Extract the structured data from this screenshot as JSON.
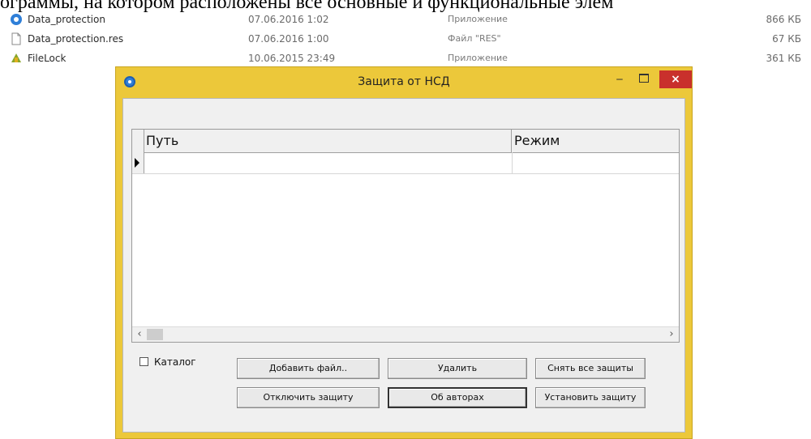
{
  "document": {
    "text_fragment": "ограммы, на котором расположены все основные и функциональные элем"
  },
  "explorer": {
    "files": [
      {
        "name": "Data_protection",
        "date": "07.06.2016 1:02",
        "type": "Приложение",
        "size": "866 КБ",
        "icon": "app-shield-icon"
      },
      {
        "name": "Data_protection.res",
        "date": "07.06.2016 1:00",
        "type": "Файл \"RES\"",
        "size": "67 КБ",
        "icon": "file-icon"
      },
      {
        "name": "FileLock",
        "date": "10.06.2015 23:49",
        "type": "Приложение",
        "size": "361 КБ",
        "icon": "filelock-app-icon"
      }
    ]
  },
  "window": {
    "title": "Защита от НСД",
    "controls": {
      "minimize": "‒",
      "close": "×"
    },
    "grid": {
      "columns": [
        "Путь",
        "Режим"
      ],
      "rows": [
        {
          "path": "",
          "mode": ""
        }
      ],
      "scroll_left": "‹",
      "scroll_right": "›"
    },
    "checkbox": {
      "label": "Каталог",
      "checked": false
    },
    "buttons": {
      "add_file": "Добавить файл..",
      "delete": "Удалить",
      "remove_all": "Снять все защиты",
      "disable": "Отключить защиту",
      "about": "Об авторах",
      "set_protection": "Установить защиту"
    }
  },
  "colors": {
    "window_frame": "#ecc83a",
    "close_button": "#c9302c",
    "client_area": "#f0f0f0"
  }
}
